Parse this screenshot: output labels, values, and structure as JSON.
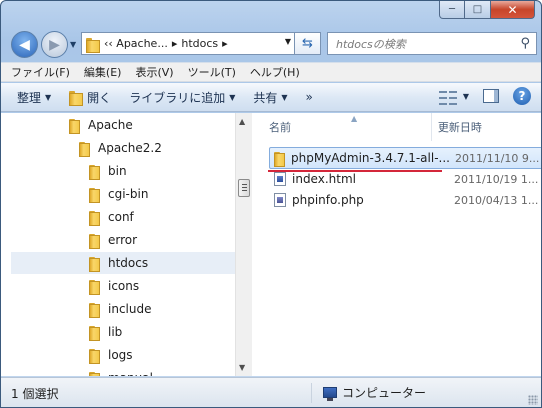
{
  "window": {
    "min_glyph": "─",
    "max_glyph": "□",
    "close_glyph": "✕"
  },
  "nav": {
    "address_segments": [
      "‹‹ Apache...",
      "htdocs"
    ],
    "address_sep": "▸",
    "search_placeholder": "htdocsの検索"
  },
  "menu": [
    "ファイル(F)",
    "編集(E)",
    "表示(V)",
    "ツール(T)",
    "ヘルプ(H)"
  ],
  "commands": {
    "organize": "整理",
    "open": "開く",
    "include_library": "ライブラリに追加",
    "share": "共有",
    "more": "»"
  },
  "tree": [
    {
      "label": "Apache",
      "level": 0
    },
    {
      "label": "Apache2.2",
      "level": 1
    },
    {
      "label": "bin",
      "level": 2
    },
    {
      "label": "cgi-bin",
      "level": 2
    },
    {
      "label": "conf",
      "level": 2
    },
    {
      "label": "error",
      "level": 2
    },
    {
      "label": "htdocs",
      "level": 2
    },
    {
      "label": "icons",
      "level": 2
    },
    {
      "label": "include",
      "level": 2
    },
    {
      "label": "lib",
      "level": 2
    },
    {
      "label": "logs",
      "level": 2
    },
    {
      "label": "manual",
      "level": 2
    }
  ],
  "columns": {
    "name": "名前",
    "date": "更新日時"
  },
  "files": [
    {
      "name": "phpMyAdmin-3.4.7.1-all-...",
      "date": "2011/11/10 9..."
    },
    {
      "name": "index.html",
      "date": "2011/10/19 1..."
    },
    {
      "name": "phpinfo.php",
      "date": "2010/04/13 1..."
    }
  ],
  "status": {
    "selection": "1 個選択",
    "location": "コンピューター"
  }
}
